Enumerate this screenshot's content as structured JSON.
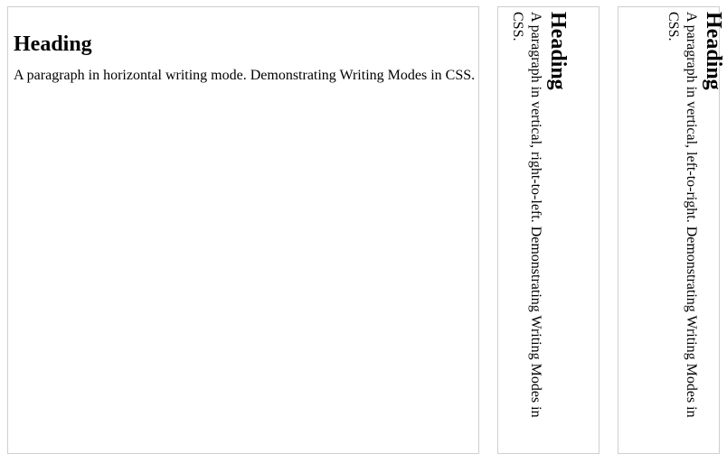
{
  "panels": {
    "horizontal": {
      "heading": "Heading",
      "paragraph": "A paragraph in horizontal writing mode. Demonstrating Writing Modes in CSS."
    },
    "vertical_rl": {
      "heading": "Heading",
      "paragraph": "A paragraph in vertical, right-to-left. Demonstrating Writing Modes in CSS."
    },
    "vertical_lr": {
      "heading": "Heading",
      "paragraph": "A paragraph in vertical, left-to-right. Demonstrating Writing Modes in CSS."
    }
  },
  "colors": {
    "border": "#cfcfcf",
    "text": "#000000",
    "background": "#ffffff"
  }
}
